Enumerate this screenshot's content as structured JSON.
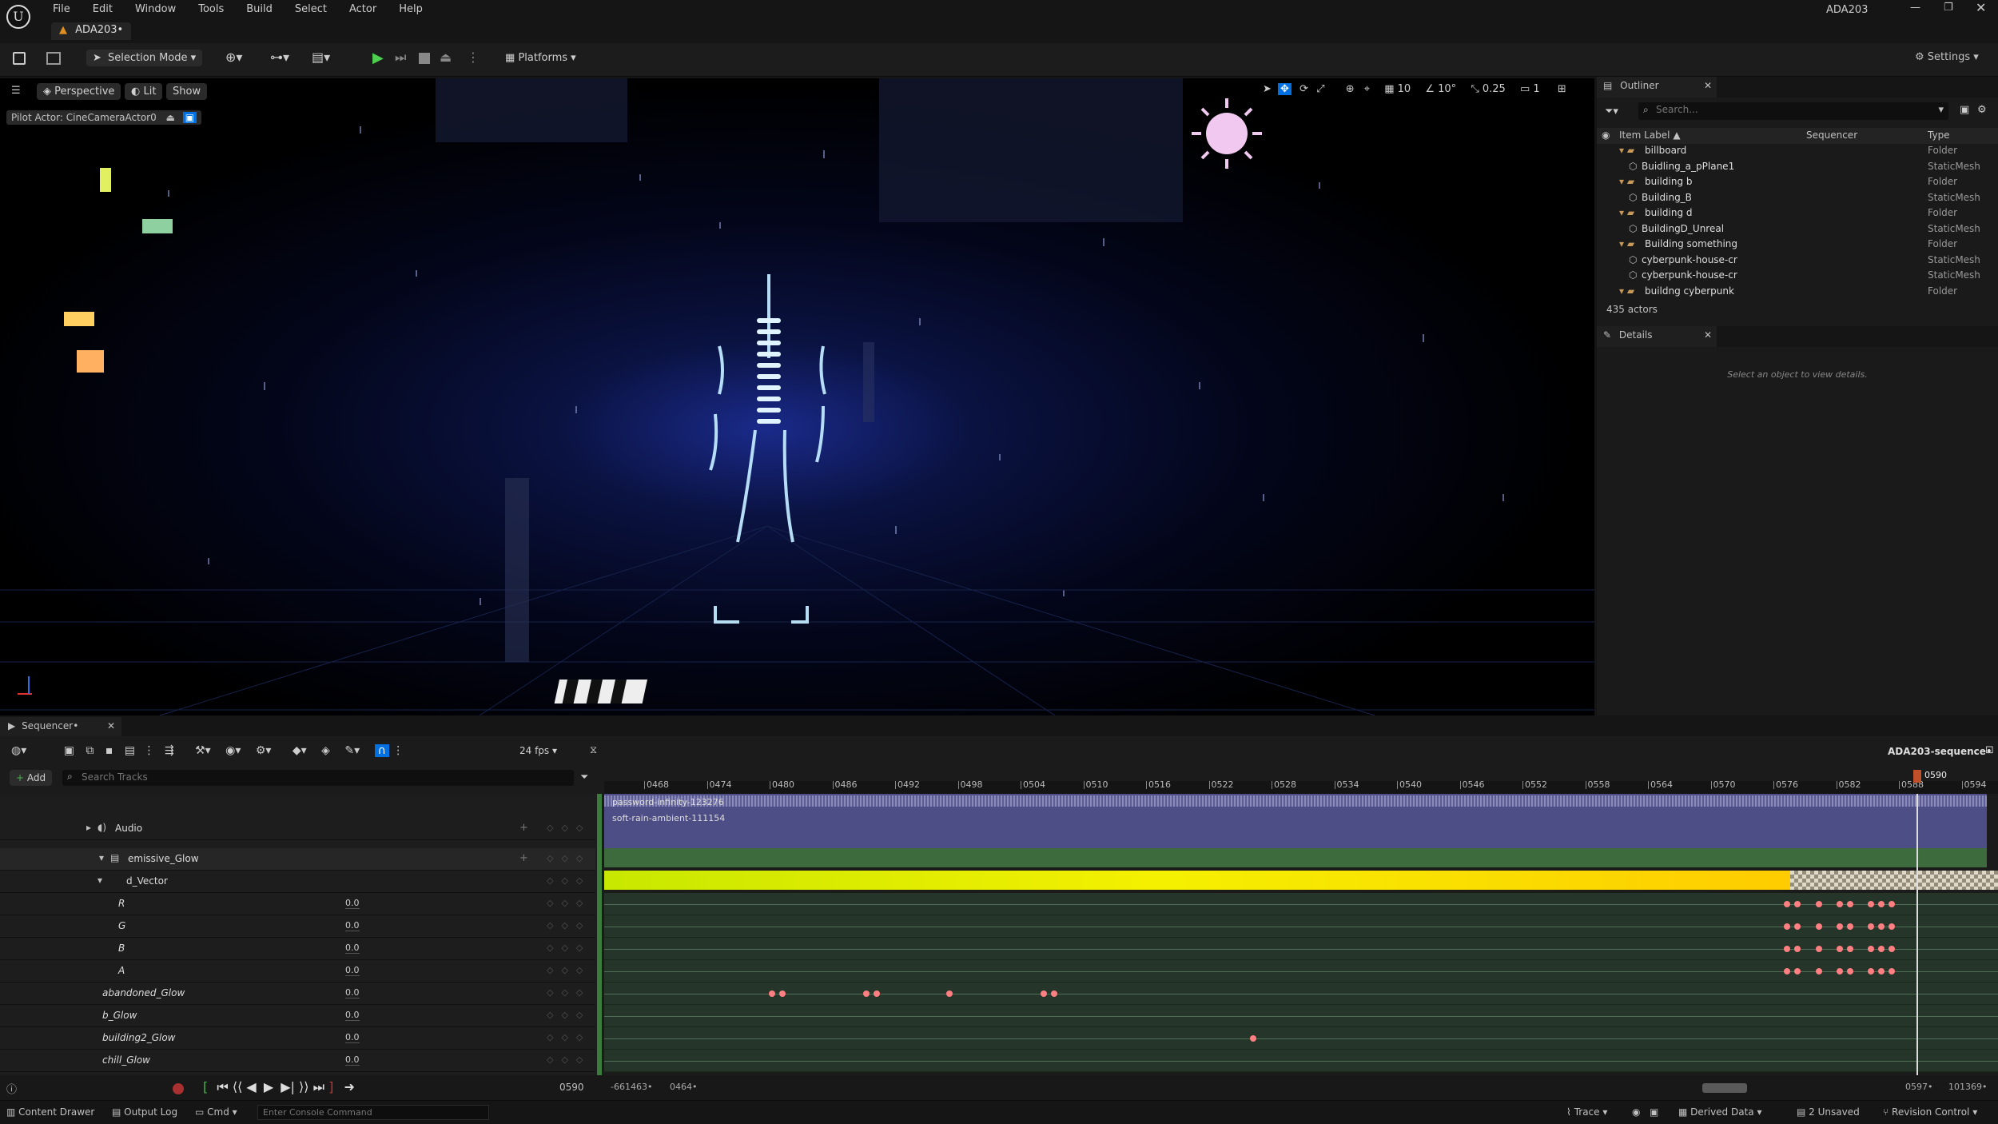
{
  "window": {
    "project_title": "ADA203",
    "tab_label": "ADA203•"
  },
  "menu": [
    "File",
    "Edit",
    "Window",
    "Tools",
    "Build",
    "Select",
    "Actor",
    "Help"
  ],
  "toolbar": {
    "selection_mode": "Selection Mode",
    "platforms": "Platforms",
    "settings": "Settings"
  },
  "viewport": {
    "perspective": "Perspective",
    "lit": "Lit",
    "show": "Show",
    "pilot_actor": "Pilot Actor: CineCameraActor0",
    "grid_snap": "10",
    "rot_snap": "10°",
    "scale_snap": "0.25",
    "camera_speed": "1"
  },
  "outliner": {
    "tab": "Outliner",
    "search_placeholder": "Search...",
    "columns": [
      "Item Label ▲",
      "Sequencer",
      "Type"
    ],
    "rows": [
      {
        "label": "billboard",
        "type": "Folder",
        "kind": "folder",
        "indent": 1
      },
      {
        "label": "Buidling_a_pPlane1",
        "type": "StaticMesh",
        "kind": "mesh",
        "indent": 2
      },
      {
        "label": "building b",
        "type": "Folder",
        "kind": "folder",
        "indent": 1
      },
      {
        "label": "Building_B",
        "type": "StaticMesh",
        "kind": "mesh",
        "indent": 2
      },
      {
        "label": "building d",
        "type": "Folder",
        "kind": "folder",
        "indent": 1
      },
      {
        "label": "BuildingD_Unreal",
        "type": "StaticMesh",
        "kind": "mesh",
        "indent": 2
      },
      {
        "label": "Building something",
        "type": "Folder",
        "kind": "folder",
        "indent": 1
      },
      {
        "label": "cyberpunk-house-cr",
        "type": "StaticMesh",
        "kind": "mesh",
        "indent": 2
      },
      {
        "label": "cyberpunk-house-cr",
        "type": "StaticMesh",
        "kind": "mesh",
        "indent": 2
      },
      {
        "label": "buildng cyberpunk",
        "type": "Folder",
        "kind": "folder",
        "indent": 1
      }
    ],
    "count": "435 actors"
  },
  "details": {
    "tab": "Details",
    "empty_text": "Select an object to view details."
  },
  "sequencer": {
    "tab": "Sequencer•",
    "fps": "24 fps",
    "sequence_name": "ADA203-sequence•",
    "add_label": "Add",
    "search_placeholder": "Search Tracks",
    "current_frame": "0590",
    "playhead_label": "0590",
    "range_start": "-661463•",
    "range_in": "0464•",
    "range_out": "0597•",
    "range_end": "101369•",
    "ticks": [
      "0468",
      "0474",
      "0480",
      "0486",
      "0492",
      "0498",
      "0504",
      "0510",
      "0516",
      "0522",
      "0528",
      "0534",
      "0540",
      "0546",
      "0552",
      "0558",
      "0564",
      "0570",
      "0576",
      "0582",
      "0588",
      "0594"
    ],
    "audio_clip_1": "password-infinity-123276",
    "audio_clip_2": "soft-rain-ambient-111154",
    "tracks": [
      {
        "label": "Audio",
        "value": ""
      },
      {
        "label": "emissive_Glow",
        "value": ""
      },
      {
        "label": "d_Vector",
        "value": ""
      },
      {
        "label": "R",
        "value": "0.0"
      },
      {
        "label": "G",
        "value": "0.0"
      },
      {
        "label": "B",
        "value": "0.0"
      },
      {
        "label": "A",
        "value": "0.0"
      },
      {
        "label": "abandoned_Glow",
        "value": "0.0"
      },
      {
        "label": "b_Glow",
        "value": "0.0"
      },
      {
        "label": "building2_Glow",
        "value": "0.0"
      },
      {
        "label": "chill_Glow",
        "value": "0.0"
      }
    ]
  },
  "status": {
    "content_drawer": "Content Drawer",
    "output_log": "Output Log",
    "cmd": "Cmd",
    "console_placeholder": "Enter Console Command",
    "trace": "Trace",
    "derived_data": "Derived Data",
    "unsaved": "2 Unsaved",
    "revision_control": "Revision Control"
  },
  "colors": {
    "accent": "#0070e0",
    "key": "#ff7f82",
    "track_green": "#3d6b3d",
    "audio_purple": "#4e4e86"
  }
}
